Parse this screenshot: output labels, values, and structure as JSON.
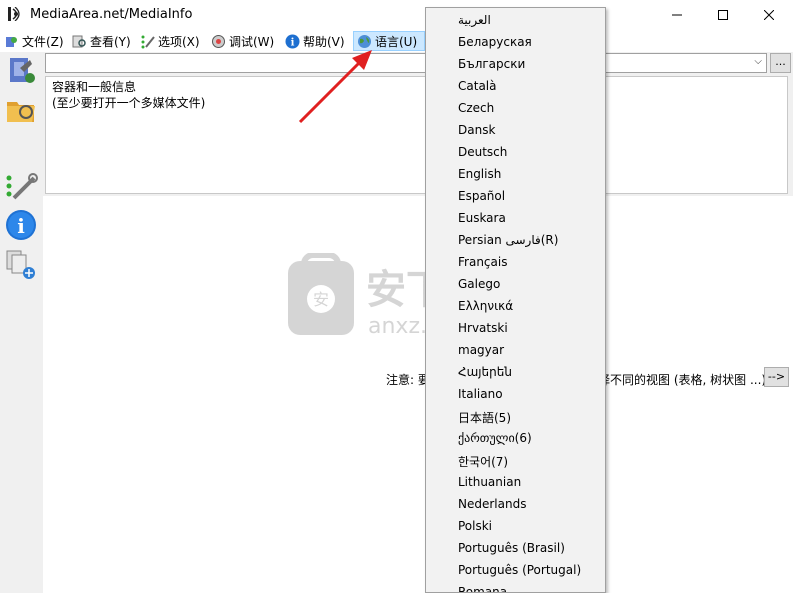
{
  "window": {
    "title": "MediaArea.net/MediaInfo"
  },
  "menu": [
    {
      "label": "文件(Z)",
      "icon": "file-icon"
    },
    {
      "label": "查看(Y)",
      "icon": "view-icon"
    },
    {
      "label": "选项(X)",
      "icon": "options-icon"
    },
    {
      "label": "调试(W)",
      "icon": "debug-icon"
    },
    {
      "label": "帮助(V)",
      "icon": "help-icon"
    },
    {
      "label": "语言(U)",
      "icon": "globe-icon"
    }
  ],
  "combo": {
    "dots_label": "..."
  },
  "info": {
    "line1": "容器和一般信息",
    "line2": "(至少要打开一个多媒体文件)"
  },
  "note": {
    "prefix": "注意: 要",
    "suffix": "择不同的视图 (表格, 树状图 ...)",
    "next_label": "-->"
  },
  "languages": [
    "العربية",
    "Беларуская",
    "Български",
    "Català",
    "Czech",
    "Dansk",
    "Deutsch",
    "English",
    "Español",
    "Euskara",
    "Persian فارسی(R)",
    "Français",
    "Galego",
    "Ελληνικά",
    "Hrvatski",
    "magyar",
    "Հայերեն",
    "Italiano",
    "日本語(5)",
    "ქართული(6)",
    "한국어(7)",
    "Lithuanian",
    "Nederlands",
    "Polski",
    "Português (Brasil)",
    "Português (Portugal)",
    "Romana"
  ],
  "watermark": {
    "brand": "安下载",
    "domain": "anxz.com"
  },
  "colors": {
    "accent": "#cce8ff",
    "arrow": "#e02020",
    "watermark": "#9a9a9a"
  }
}
